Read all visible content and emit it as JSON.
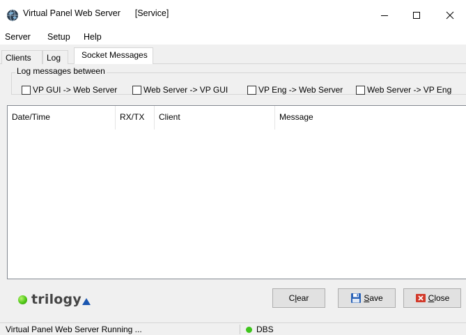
{
  "window": {
    "title": "Virtual Panel Web Server",
    "subtitle": "[Service]"
  },
  "menu": {
    "items": [
      "Server",
      "Setup",
      "Help"
    ]
  },
  "tabs": [
    {
      "label": "Clients",
      "active": false
    },
    {
      "label": "Log",
      "active": false
    },
    {
      "label": "Socket Messages",
      "active": true
    }
  ],
  "log_filter": {
    "legend": "Log messages between",
    "options": [
      {
        "label": "VP GUI -> Web Server",
        "checked": false
      },
      {
        "label": "Web Server -> VP GUI",
        "checked": false
      },
      {
        "label": "VP Eng -> Web Server",
        "checked": false
      },
      {
        "label": "Web Server -> VP Eng",
        "checked": false
      }
    ]
  },
  "table": {
    "columns": [
      "Date/Time",
      "RX/TX",
      "Client",
      "Message"
    ],
    "rows": []
  },
  "brand": {
    "logo_text": "trilogy",
    "dot_color": "#4fc716",
    "triangle_color": "#1a56b0"
  },
  "buttons": {
    "clear_label": "Clear",
    "save_label": "Save",
    "close_label": "Close"
  },
  "status": {
    "message": "Virtual Panel Web Server Running ...",
    "db_label": "DBS",
    "db_indicator_color": "#3ec51c"
  }
}
